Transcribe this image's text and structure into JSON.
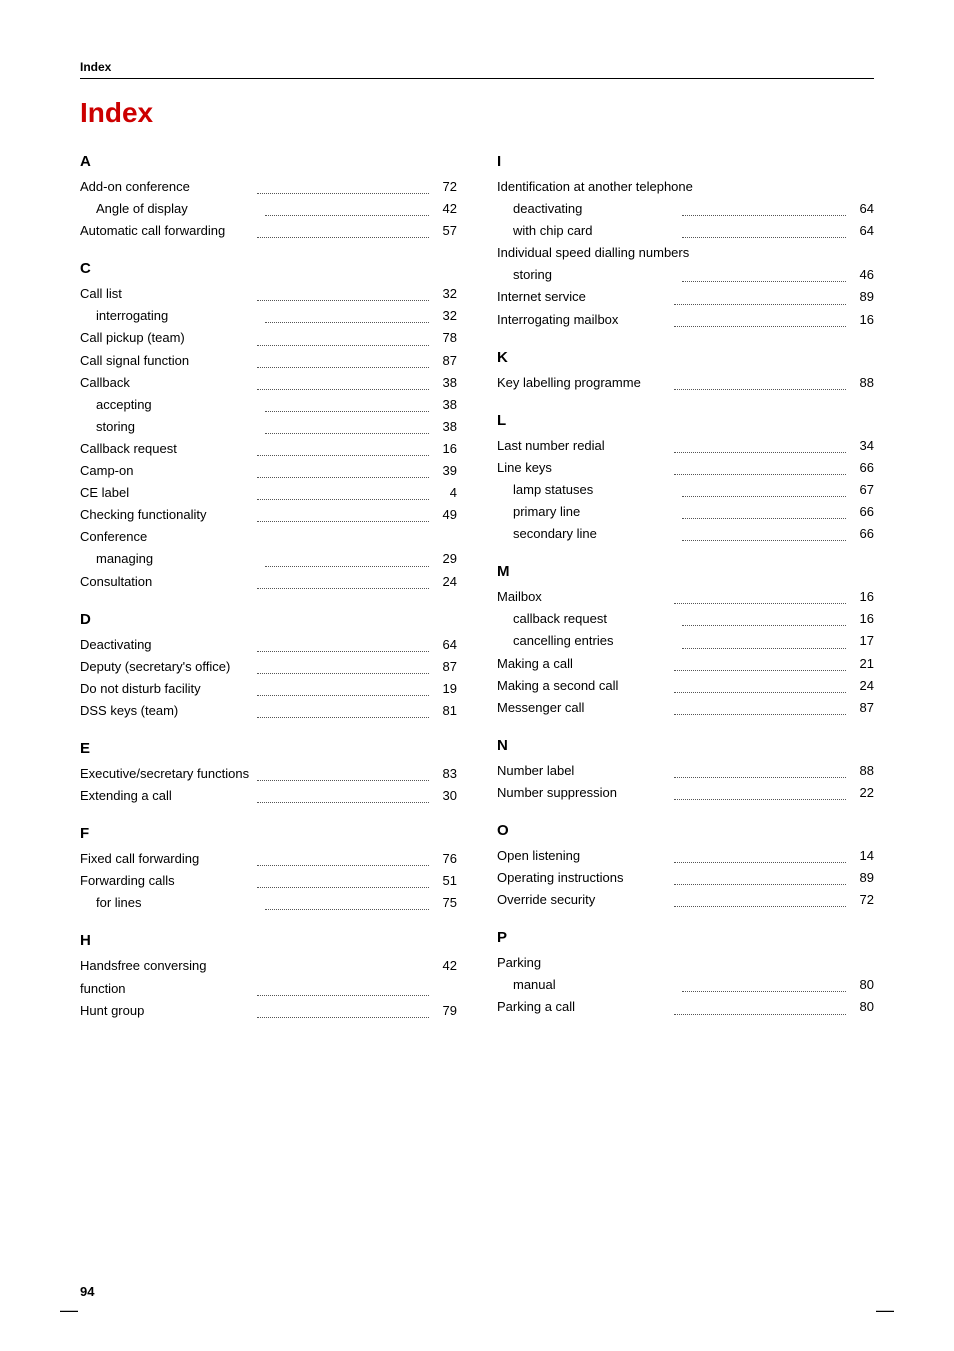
{
  "header": {
    "label": "Index"
  },
  "page_title": "Index",
  "page_number": "94",
  "left_column": {
    "sections": [
      {
        "letter": "A",
        "entries": [
          {
            "label": "Add-on conference",
            "indent": 0,
            "page": "72"
          },
          {
            "label": "Angle of display",
            "indent": 1,
            "page": "42"
          },
          {
            "label": "Automatic call forwarding",
            "indent": 0,
            "page": "57"
          }
        ]
      },
      {
        "letter": "C",
        "entries": [
          {
            "label": "Call list",
            "indent": 0,
            "page": "32"
          },
          {
            "label": "interrogating",
            "indent": 1,
            "page": "32"
          },
          {
            "label": "Call pickup (team)",
            "indent": 0,
            "page": "78"
          },
          {
            "label": "Call signal function",
            "indent": 0,
            "page": "87"
          },
          {
            "label": "Callback",
            "indent": 0,
            "page": "38"
          },
          {
            "label": "accepting",
            "indent": 1,
            "page": "38"
          },
          {
            "label": "storing",
            "indent": 1,
            "page": "38"
          },
          {
            "label": "Callback request",
            "indent": 0,
            "page": "16"
          },
          {
            "label": "Camp-on",
            "indent": 0,
            "page": "39"
          },
          {
            "label": "CE label",
            "indent": 0,
            "page": "4"
          },
          {
            "label": "Checking functionality",
            "indent": 0,
            "page": "49"
          },
          {
            "label": "Conference",
            "indent": 0,
            "page": ""
          },
          {
            "label": "managing",
            "indent": 1,
            "page": "29"
          },
          {
            "label": "Consultation",
            "indent": 0,
            "page": "24"
          }
        ]
      },
      {
        "letter": "D",
        "entries": [
          {
            "label": "Deactivating",
            "indent": 0,
            "page": "64"
          },
          {
            "label": "Deputy (secretary's office)",
            "indent": 0,
            "page": "87"
          },
          {
            "label": "Do not disturb facility",
            "indent": 0,
            "page": "19"
          },
          {
            "label": "DSS keys (team)",
            "indent": 0,
            "page": "81"
          }
        ]
      },
      {
        "letter": "E",
        "entries": [
          {
            "label": "Executive/secretary functions",
            "indent": 0,
            "page": "83"
          },
          {
            "label": "Extending a call",
            "indent": 0,
            "page": "30"
          }
        ]
      },
      {
        "letter": "F",
        "entries": [
          {
            "label": "Fixed call forwarding",
            "indent": 0,
            "page": "76"
          },
          {
            "label": "Forwarding calls",
            "indent": 0,
            "page": "51"
          },
          {
            "label": "for lines",
            "indent": 1,
            "page": "75"
          }
        ]
      },
      {
        "letter": "H",
        "entries": [
          {
            "label": "Handsfree conversing function",
            "indent": 0,
            "page": "42"
          },
          {
            "label": "Hunt group",
            "indent": 0,
            "page": "79"
          }
        ]
      }
    ]
  },
  "right_column": {
    "sections": [
      {
        "letter": "I",
        "entries": [
          {
            "label": "Identification at another telephone",
            "indent": 0,
            "page": ""
          },
          {
            "label": "deactivating",
            "indent": 1,
            "page": "64"
          },
          {
            "label": "with chip card",
            "indent": 1,
            "page": "64"
          },
          {
            "label": "Individual speed dialling numbers",
            "indent": 0,
            "page": ""
          },
          {
            "label": "storing",
            "indent": 1,
            "page": "46"
          },
          {
            "label": "Internet service",
            "indent": 0,
            "page": "89"
          },
          {
            "label": "Interrogating mailbox",
            "indent": 0,
            "page": "16"
          }
        ]
      },
      {
        "letter": "K",
        "entries": [
          {
            "label": "Key labelling programme",
            "indent": 0,
            "page": "88"
          }
        ]
      },
      {
        "letter": "L",
        "entries": [
          {
            "label": "Last number redial",
            "indent": 0,
            "page": "34"
          },
          {
            "label": "Line keys",
            "indent": 0,
            "page": "66"
          },
          {
            "label": "lamp statuses",
            "indent": 1,
            "page": "67"
          },
          {
            "label": "primary line",
            "indent": 1,
            "page": "66"
          },
          {
            "label": "secondary line",
            "indent": 1,
            "page": "66"
          }
        ]
      },
      {
        "letter": "M",
        "entries": [
          {
            "label": "Mailbox",
            "indent": 0,
            "page": "16"
          },
          {
            "label": "callback request",
            "indent": 1,
            "page": "16"
          },
          {
            "label": "cancelling entries",
            "indent": 1,
            "page": "17"
          },
          {
            "label": "Making a call",
            "indent": 0,
            "page": "21"
          },
          {
            "label": "Making a second call",
            "indent": 0,
            "page": "24"
          },
          {
            "label": "Messenger call",
            "indent": 0,
            "page": "87"
          }
        ]
      },
      {
        "letter": "N",
        "entries": [
          {
            "label": "Number label",
            "indent": 0,
            "page": "88"
          },
          {
            "label": "Number suppression",
            "indent": 0,
            "page": "22"
          }
        ]
      },
      {
        "letter": "O",
        "entries": [
          {
            "label": "Open listening",
            "indent": 0,
            "page": "14"
          },
          {
            "label": "Operating instructions",
            "indent": 0,
            "page": "89"
          },
          {
            "label": "Override security",
            "indent": 0,
            "page": "72"
          }
        ]
      },
      {
        "letter": "P",
        "entries": [
          {
            "label": "Parking",
            "indent": 0,
            "page": ""
          },
          {
            "label": "manual",
            "indent": 1,
            "page": "80"
          },
          {
            "label": "Parking a call",
            "indent": 0,
            "page": "80"
          }
        ]
      }
    ]
  }
}
